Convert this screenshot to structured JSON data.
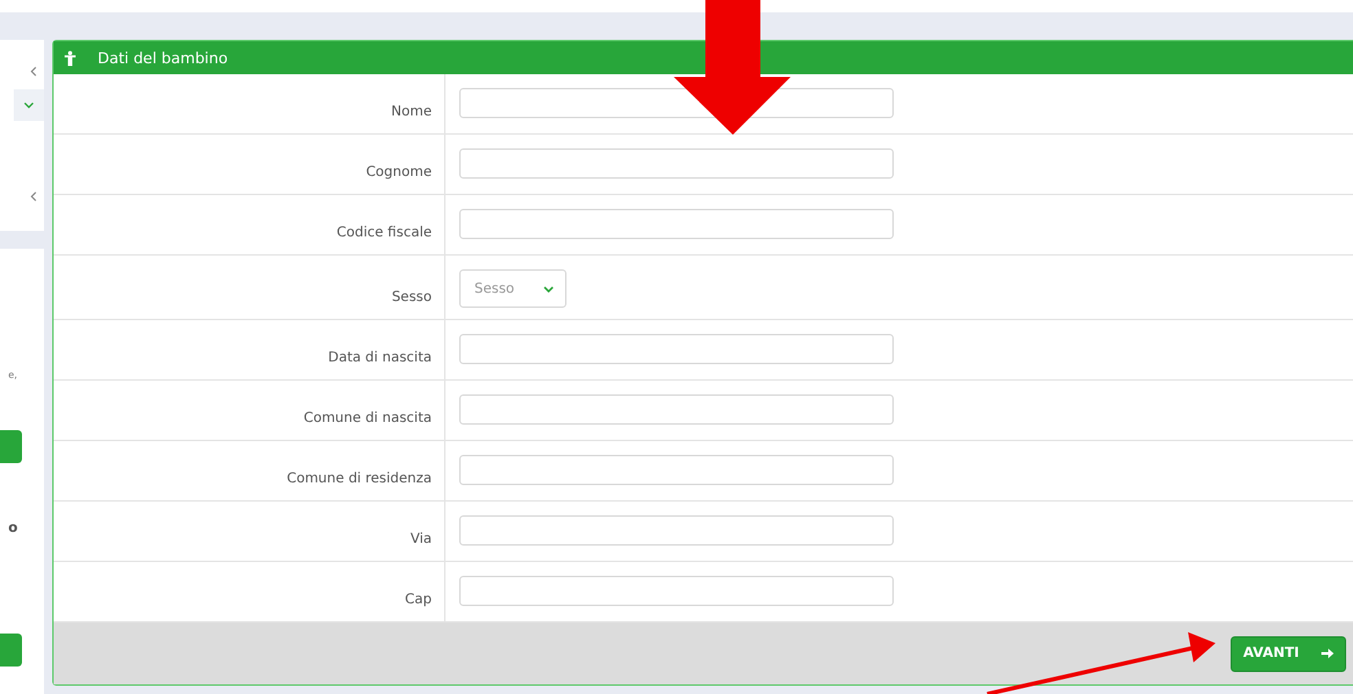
{
  "sidebar": {
    "texts": [
      "e,",
      "o"
    ]
  },
  "panel": {
    "title": "Dati del bambino",
    "fields": [
      {
        "label": "Nome",
        "kind": "text"
      },
      {
        "label": "Cognome",
        "kind": "text"
      },
      {
        "label": "Codice fiscale",
        "kind": "text"
      },
      {
        "label": "Sesso",
        "kind": "select",
        "placeholder": "Sesso"
      },
      {
        "label": "Data di nascita",
        "kind": "text"
      },
      {
        "label": "Comune di nascita",
        "kind": "text"
      },
      {
        "label": "Comune di residenza",
        "kind": "text"
      },
      {
        "label": "Via",
        "kind": "text"
      },
      {
        "label": "Cap",
        "kind": "text"
      }
    ],
    "button": "AVANTI"
  }
}
